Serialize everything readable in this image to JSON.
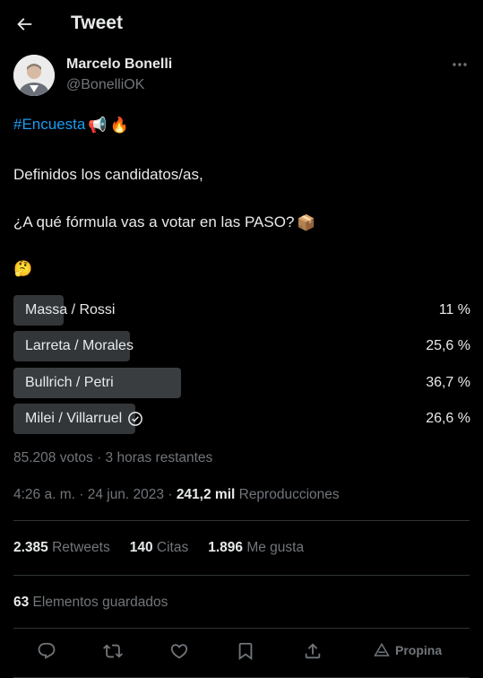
{
  "header": {
    "title": "Tweet",
    "back_icon": "arrow-left-icon"
  },
  "author": {
    "name": "Marcelo Bonelli",
    "handle": "@BonelliOK"
  },
  "tweet": {
    "hashtag": "#Encuesta",
    "line1_emojis": [
      "📢",
      "🔥"
    ],
    "line2": "Definidos los candidatos/as,",
    "line3": "¿A qué fórmula vas a votar en las PASO?",
    "line3_emoji": "📦",
    "line4_emoji": "🤔"
  },
  "poll": {
    "options": [
      {
        "label": "Massa / Rossi",
        "percent_text": "11 %",
        "percent": 11
      },
      {
        "label": "Larreta / Morales",
        "percent_text": "25,6 %",
        "percent": 25.6
      },
      {
        "label": "Bullrich / Petri",
        "percent_text": "36,7 %",
        "percent": 36.7
      },
      {
        "label": "Milei / Villarruel",
        "percent_text": "26,6 %",
        "percent": 26.6,
        "voted": true
      }
    ],
    "summary": "85.208 votos · 3 horas restantes"
  },
  "timestamp": {
    "time": "4:26 a. m. · 24 jun. 2023 · ",
    "views_count": "241,2 mil",
    "views_label": " Reproducciones"
  },
  "stats": {
    "retweets_count": "2.385",
    "retweets_label": " Retweets",
    "quotes_count": "140",
    "quotes_label": " Citas",
    "likes_count": "1.896",
    "likes_label": " Me gusta"
  },
  "bookmarks": {
    "count": "63",
    "label": " Elementos guardados"
  },
  "actions": {
    "promote_label": "Propina"
  },
  "colors": {
    "accent": "#1d9bf0",
    "secondary_text": "#71767b",
    "poll_bar": "#333639"
  }
}
